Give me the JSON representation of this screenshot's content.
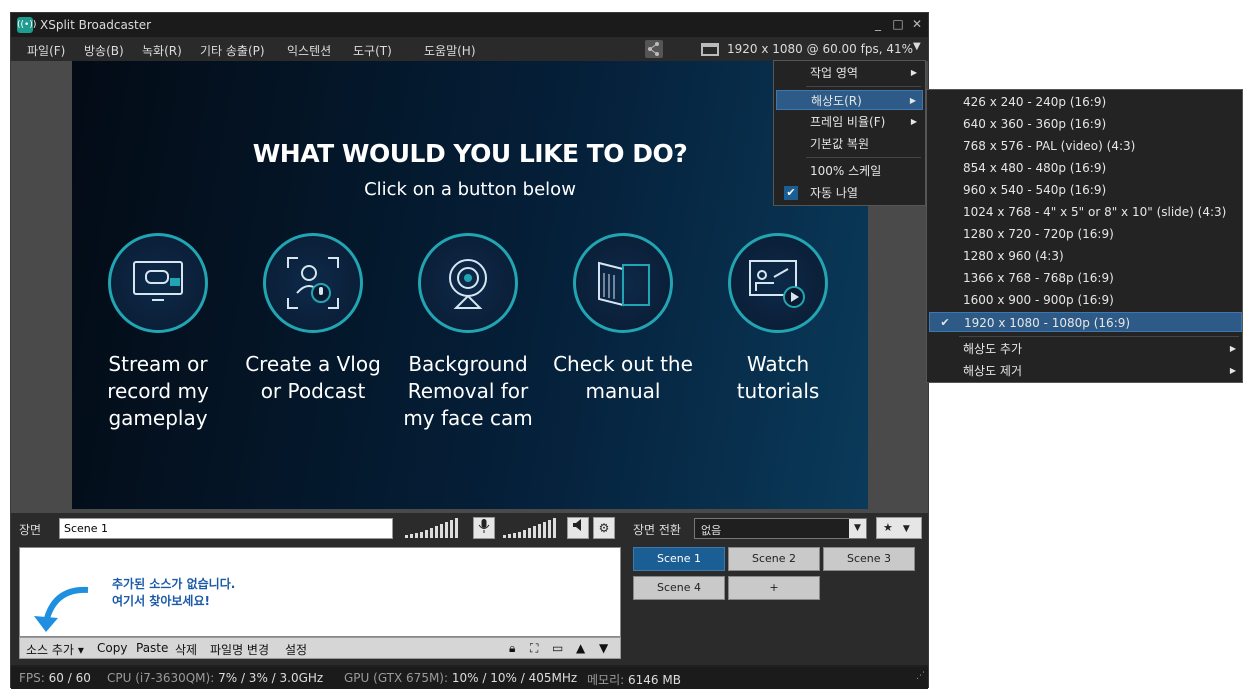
{
  "window": {
    "title": "XSplit Broadcaster",
    "minimize": "_",
    "maximize": "□",
    "close": "✕"
  },
  "menu": [
    "파일(F)",
    "방송(B)",
    "녹화(R)",
    "기타 송출(P)",
    "익스텐션",
    "도구(T)",
    "도움말(H)"
  ],
  "resolution_display": "1920 x 1080 @ 60.00 fps, 41%",
  "canvas": {
    "heading": "WHAT WOULD YOU LIKE TO DO?",
    "subheading": "Click on a button below",
    "options": [
      {
        "icon": "gamepad-monitor-icon",
        "label": "Stream or record my gameplay"
      },
      {
        "icon": "vlog-mic-icon",
        "label": "Create a Vlog or Podcast"
      },
      {
        "icon": "webcam-icon",
        "label": "Background Removal for my face cam"
      },
      {
        "icon": "manual-book-icon",
        "label": "Check out the manual"
      },
      {
        "icon": "tutorial-video-icon",
        "label": "Watch tutorials"
      }
    ]
  },
  "scene": {
    "label": "장면",
    "name": "Scene 1"
  },
  "transition": {
    "label": "장면 전환",
    "value": "없음"
  },
  "sources": {
    "empty_line1": "추가된 소스가 없습니다.",
    "empty_line2": "여기서 찾아보세요!",
    "toolbar": [
      "소스 추가",
      "Copy",
      "Paste",
      "삭제",
      "파일명 변경",
      "설정"
    ],
    "add_caret": "▾"
  },
  "scenes": [
    "Scene 1",
    "Scene 2",
    "Scene 3",
    "Scene 4",
    "+"
  ],
  "status": {
    "fps_label": "FPS:",
    "fps_value": "60 / 60",
    "cpu_label": "CPU (i7-3630QM):",
    "cpu_value": "7% / 3% / 3.0GHz",
    "gpu_label": "GPU (GTX 675M):",
    "gpu_value": "10% / 10% / 405MHz",
    "mem_label": "메모리:",
    "mem_value": "6146 MB"
  },
  "context_menu": {
    "items": [
      {
        "label": "작업 영역",
        "submenu": true,
        "checked": false
      },
      {
        "label": "해상도(R)",
        "submenu": true,
        "checked": false,
        "highlighted": true
      },
      {
        "label": "프레임 비율(F)",
        "submenu": true,
        "checked": false
      },
      {
        "label": "기본값 복원",
        "submenu": false,
        "checked": false
      },
      {
        "label": "100% 스케일",
        "submenu": false,
        "checked": false
      },
      {
        "label": "자동 나열",
        "submenu": false,
        "checked": true
      }
    ]
  },
  "resolution_menu": {
    "items": [
      "426 x 240 - 240p (16:9)",
      "640 x 360 - 360p (16:9)",
      "768 x 576 - PAL (video) (4:3)",
      "854 x 480 - 480p (16:9)",
      "960 x 540 - 540p (16:9)",
      "1024 x 768 - 4\" x 5\" or 8\" x 10\" (slide) (4:3)",
      "1280 x 720 - 720p (16:9)",
      "1280 x 960 (4:3)",
      "1366 x 768 - 768p (16:9)",
      "1600 x 900 - 900p (16:9)",
      "1920 x 1080 - 1080p (16:9)"
    ],
    "selected_index": 10,
    "add": "해상도 추가",
    "remove": "해상도 제거"
  },
  "colors": {
    "accent": "#1b5e93",
    "teal": "#22a5b2",
    "message": "#1a5aa8"
  }
}
